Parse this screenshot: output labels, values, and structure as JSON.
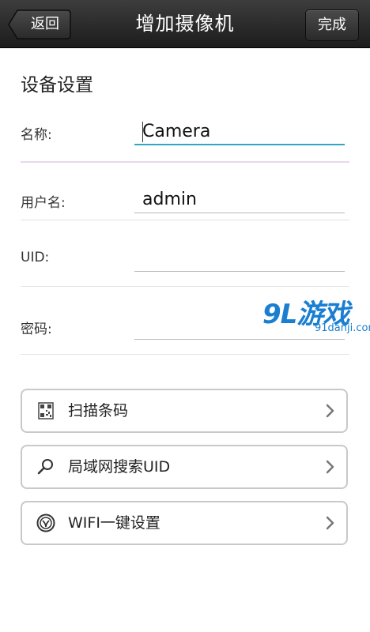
{
  "header": {
    "title": "增加摄像机",
    "back_label": "返回",
    "done_label": "完成"
  },
  "section": {
    "title": "设备设置"
  },
  "form": {
    "name": {
      "label": "名称:",
      "value": "Camera"
    },
    "username": {
      "label": "用户名:",
      "value": "admin"
    },
    "uid": {
      "label": "UID:",
      "value": ""
    },
    "password": {
      "label": "密码:",
      "value": ""
    }
  },
  "actions": [
    {
      "label": "扫描条码",
      "icon": "qr-code-icon"
    },
    {
      "label": "局域网搜索UID",
      "icon": "search-icon"
    },
    {
      "label": "WIFI一键设置",
      "icon": "wifi-setup-icon"
    }
  ],
  "watermark": {
    "logo": "9L游戏",
    "site": "91danji.com"
  },
  "colors": {
    "focus": "#2fa6c4",
    "topbar": "#2a2a2a",
    "watermark": "#1a7fd1"
  }
}
